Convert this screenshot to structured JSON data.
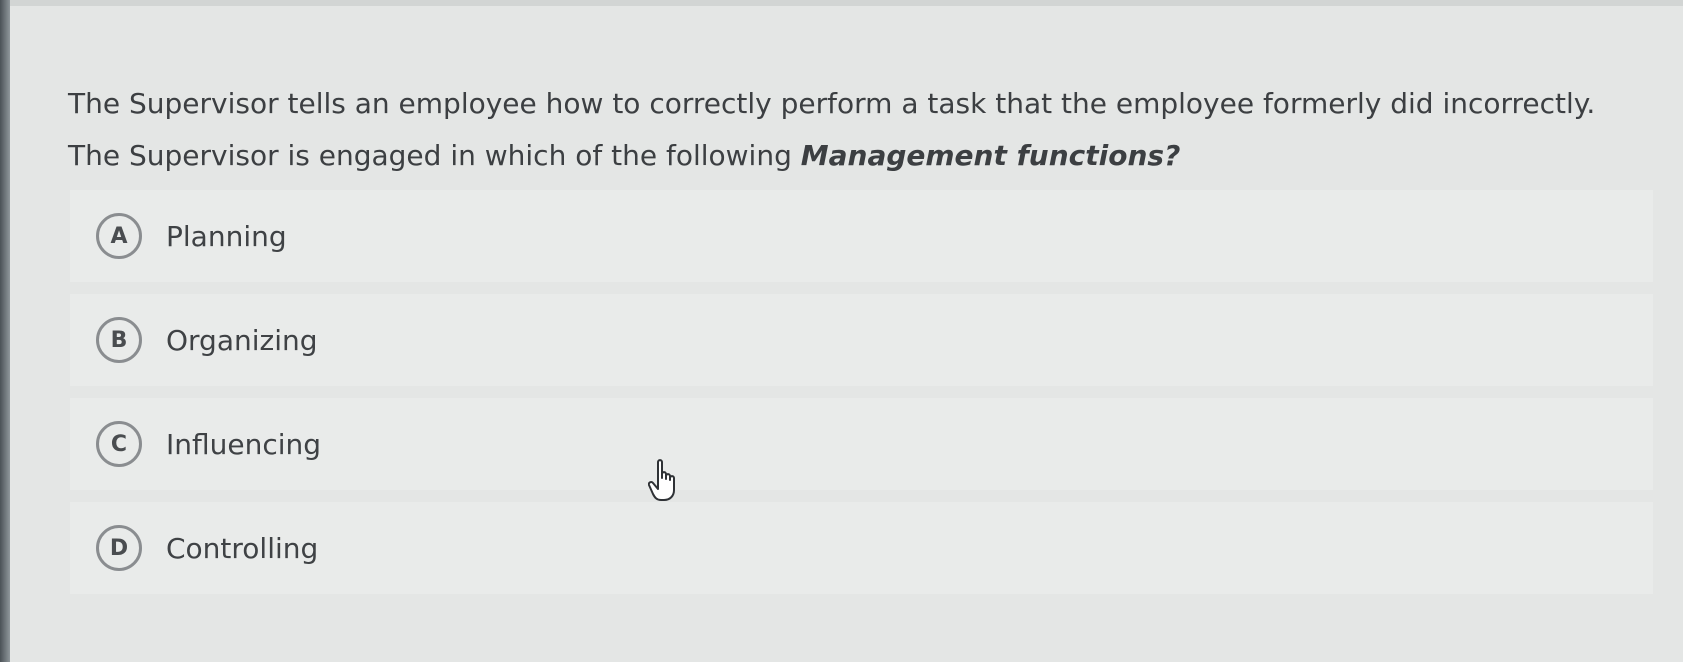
{
  "question": {
    "text_part1": "The Supervisor tells an employee how to correctly perform a task that the employee formerly did incorrectly. The Supervisor is engaged in which of the following ",
    "emphasis": "Management functions?"
  },
  "options": [
    {
      "letter": "A",
      "label": "Planning"
    },
    {
      "letter": "B",
      "label": "Organizing"
    },
    {
      "letter": "C",
      "label": "Influencing"
    },
    {
      "letter": "D",
      "label": "Controlling"
    }
  ],
  "cursor": {
    "icon": "hand-pointer-icon"
  }
}
